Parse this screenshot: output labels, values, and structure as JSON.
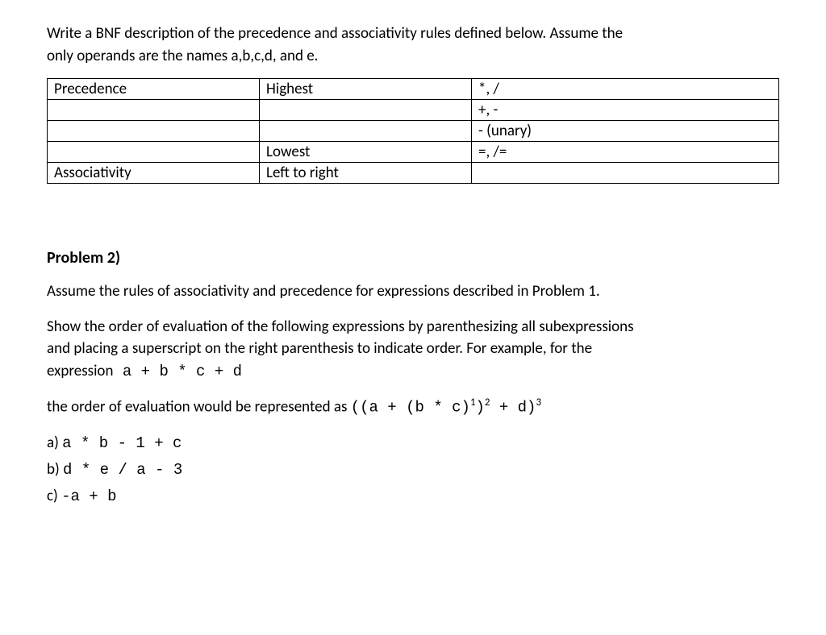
{
  "intro_line1": "Write a BNF description of the precedence and associativity rules defined below. Assume the",
  "intro_line2": "only operands are the names a,b,c,d, and e.",
  "table": {
    "rows": [
      {
        "c1": "Precedence",
        "c2": "Highest",
        "c3": "*, /"
      },
      {
        "c1": "",
        "c2": "",
        "c3": "+, -"
      },
      {
        "c1": "",
        "c2": "",
        "c3": "- (unary)"
      },
      {
        "c1": "",
        "c2": "Lowest",
        "c3": "=, /="
      },
      {
        "c1": "Associativity",
        "c2": "Left to right",
        "c3": ""
      }
    ]
  },
  "problem2": {
    "heading": "Problem 2)",
    "p1": "Assume the rules of associativity and precedence for expressions described in Problem 1.",
    "p2a": "Show the order of evaluation of the following expressions by parenthesizing all subexpressions",
    "p2b": "and placing a superscript on the right parenthesis to indicate order. For example, for the",
    "p2c_prefix": "expression",
    "p2c_expr": "  a + b * c + d",
    "order_prefix": "the order of evaluation would be represented as ",
    "order_expr_part1": "((a + (b * c)",
    "order_sup1": "1",
    "order_expr_part2": ")",
    "order_sup2": "2",
    "order_expr_part3": "  + d)",
    "order_sup3": "3",
    "items": {
      "a_label": "a) ",
      "a_expr": "a * b - 1 + c",
      "b_label": "b) ",
      "b_expr": "d * e / a - 3",
      "c_label": "c) ",
      "c_expr": "-a + b"
    }
  }
}
